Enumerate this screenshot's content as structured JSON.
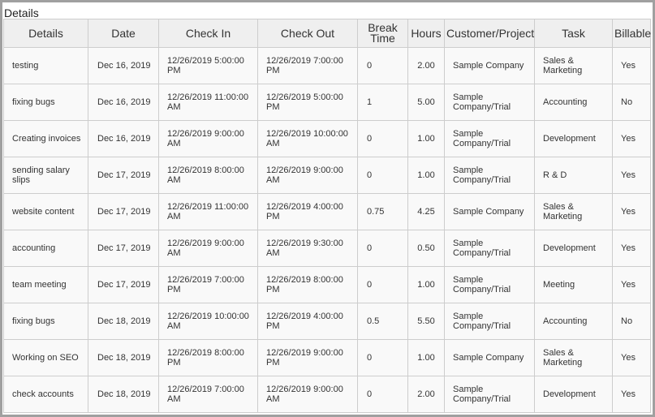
{
  "panel": {
    "title": "Details"
  },
  "table": {
    "columns": {
      "details": "Details",
      "date": "Date",
      "check_in": "Check In",
      "check_out": "Check Out",
      "break_time": "Break Time",
      "hours": "Hours",
      "customer_project": "Customer/Project",
      "task": "Task",
      "billable": "Billable"
    },
    "rows": [
      {
        "details": "testing",
        "date": "Dec 16, 2019",
        "check_in": "12/26/2019 5:00:00 PM",
        "check_out": "12/26/2019 7:00:00 PM",
        "break_time": "0",
        "hours": "2.00",
        "customer_project": "Sample Company",
        "task": "Sales & Marketing",
        "billable": "Yes"
      },
      {
        "details": "fixing bugs",
        "date": "Dec 16, 2019",
        "check_in": "12/26/2019 11:00:00 AM",
        "check_out": "12/26/2019 5:00:00 PM",
        "break_time": "1",
        "hours": "5.00",
        "customer_project": "Sample Company/Trial",
        "task": "Accounting",
        "billable": "No"
      },
      {
        "details": "Creating invoices",
        "date": "Dec 16, 2019",
        "check_in": "12/26/2019 9:00:00 AM",
        "check_out": "12/26/2019 10:00:00 AM",
        "break_time": "0",
        "hours": "1.00",
        "customer_project": "Sample Company/Trial",
        "task": "Development",
        "billable": "Yes"
      },
      {
        "details": "sending salary slips",
        "date": "Dec 17, 2019",
        "check_in": "12/26/2019 8:00:00 AM",
        "check_out": "12/26/2019 9:00:00 AM",
        "break_time": "0",
        "hours": "1.00",
        "customer_project": "Sample Company/Trial",
        "task": "R & D",
        "billable": "Yes"
      },
      {
        "details": "website content",
        "date": "Dec 17, 2019",
        "check_in": "12/26/2019 11:00:00 AM",
        "check_out": "12/26/2019 4:00:00 PM",
        "break_time": "0.75",
        "hours": "4.25",
        "customer_project": "Sample Company",
        "task": "Sales & Marketing",
        "billable": "Yes"
      },
      {
        "details": "accounting",
        "date": "Dec 17, 2019",
        "check_in": "12/26/2019 9:00:00 AM",
        "check_out": "12/26/2019 9:30:00 AM",
        "break_time": "0",
        "hours": "0.50",
        "customer_project": "Sample Company/Trial",
        "task": "Development",
        "billable": "Yes"
      },
      {
        "details": "team meeting",
        "date": "Dec 17, 2019",
        "check_in": "12/26/2019 7:00:00 PM",
        "check_out": "12/26/2019 8:00:00 PM",
        "break_time": "0",
        "hours": "1.00",
        "customer_project": "Sample Company/Trial",
        "task": "Meeting",
        "billable": "Yes"
      },
      {
        "details": "fixing bugs",
        "date": "Dec 18, 2019",
        "check_in": "12/26/2019 10:00:00 AM",
        "check_out": "12/26/2019 4:00:00 PM",
        "break_time": "0.5",
        "hours": "5.50",
        "customer_project": "Sample Company/Trial",
        "task": "Accounting",
        "billable": "No"
      },
      {
        "details": "Working on SEO",
        "date": "Dec 18, 2019",
        "check_in": "12/26/2019 8:00:00 PM",
        "check_out": "12/26/2019 9:00:00 PM",
        "break_time": "0",
        "hours": "1.00",
        "customer_project": "Sample Company",
        "task": "Sales & Marketing",
        "billable": "Yes"
      },
      {
        "details": "check accounts",
        "date": "Dec 18, 2019",
        "check_in": "12/26/2019 7:00:00 AM",
        "check_out": "12/26/2019 9:00:00 AM",
        "break_time": "0",
        "hours": "2.00",
        "customer_project": "Sample Company/Trial",
        "task": "Development",
        "billable": "Yes"
      }
    ]
  }
}
